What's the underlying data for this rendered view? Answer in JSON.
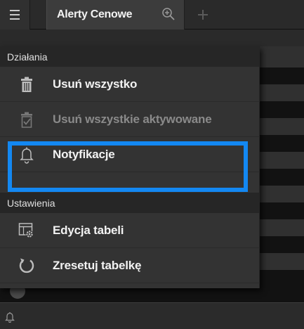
{
  "topbar": {
    "tab_label": "Alerty Cenowe",
    "icons": [
      "hamburger-icon",
      "zoom-in-icon",
      "plus-icon"
    ]
  },
  "menu": {
    "sections": [
      {
        "header": "Działania",
        "items": [
          {
            "label": "Usuń wszystko",
            "icon": "trash-icon",
            "enabled": true
          },
          {
            "label": "Usuń wszystkie aktywowane",
            "icon": "trash-check-icon",
            "enabled": false
          },
          {
            "label": "Notyfikacje",
            "icon": "bell-icon",
            "enabled": true,
            "highlighted": true
          }
        ]
      },
      {
        "header": "Ustawienia",
        "items": [
          {
            "label": "Edycja tabeli",
            "icon": "table-settings-icon",
            "enabled": true
          },
          {
            "label": "Zresetuj tabelkę",
            "icon": "reset-icon",
            "enabled": true
          }
        ]
      }
    ]
  },
  "colors": {
    "highlight": "#1388f2",
    "menu_bg": "#333333",
    "header_bg": "#262626",
    "page_bg": "#1b1b1b"
  }
}
